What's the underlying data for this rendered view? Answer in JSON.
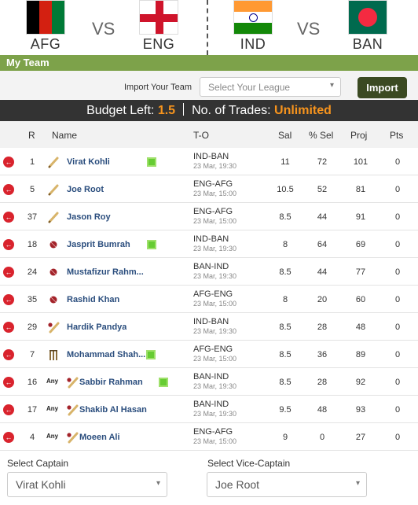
{
  "matches": [
    {
      "home": "AFG",
      "away": "ENG",
      "vs": "VS"
    },
    {
      "home": "IND",
      "away": "BAN",
      "vs": "VS"
    }
  ],
  "section_title": "My Team",
  "import": {
    "label": "Import Your Team",
    "league_placeholder": "Select Your League",
    "button": "Import"
  },
  "budget": {
    "budget_label": "Budget Left:",
    "budget_value": "1.5",
    "trades_label": "No. of Trades:",
    "trades_value": "Unlimited"
  },
  "columns": [
    "R",
    "Name",
    "T-O",
    "Sal",
    "% Sel",
    "Proj",
    "Pts"
  ],
  "players": [
    {
      "rank": "1",
      "any": "",
      "role": "bat",
      "name": "Virat Kohli",
      "badge": true,
      "match": "IND-BAN",
      "date": "23 Mar, 19:30",
      "sal": "11",
      "sel": "72",
      "proj": "101",
      "pts": "0"
    },
    {
      "rank": "5",
      "any": "",
      "role": "bat",
      "name": "Joe Root",
      "badge": false,
      "match": "ENG-AFG",
      "date": "23 Mar, 15:00",
      "sal": "10.5",
      "sel": "52",
      "proj": "81",
      "pts": "0"
    },
    {
      "rank": "37",
      "any": "",
      "role": "bat",
      "name": "Jason Roy",
      "badge": false,
      "match": "ENG-AFG",
      "date": "23 Mar, 15:00",
      "sal": "8.5",
      "sel": "44",
      "proj": "91",
      "pts": "0"
    },
    {
      "rank": "18",
      "any": "",
      "role": "bowl",
      "name": "Jasprit Bumrah",
      "badge": true,
      "match": "IND-BAN",
      "date": "23 Mar, 19:30",
      "sal": "8",
      "sel": "64",
      "proj": "69",
      "pts": "0"
    },
    {
      "rank": "24",
      "any": "",
      "role": "bowl",
      "name": "Mustafizur Rahm...",
      "badge": false,
      "match": "BAN-IND",
      "date": "23 Mar, 19:30",
      "sal": "8.5",
      "sel": "44",
      "proj": "77",
      "pts": "0"
    },
    {
      "rank": "35",
      "any": "",
      "role": "bowl",
      "name": "Rashid Khan",
      "badge": false,
      "match": "AFG-ENG",
      "date": "23 Mar, 15:00",
      "sal": "8",
      "sel": "20",
      "proj": "60",
      "pts": "0"
    },
    {
      "rank": "29",
      "any": "",
      "role": "allround",
      "name": "Hardik Pandya",
      "badge": false,
      "match": "IND-BAN",
      "date": "23 Mar, 19:30",
      "sal": "8.5",
      "sel": "28",
      "proj": "48",
      "pts": "0"
    },
    {
      "rank": "7",
      "any": "",
      "role": "wk",
      "name": "Mohammad Shah...",
      "badge": true,
      "match": "AFG-ENG",
      "date": "23 Mar, 15:00",
      "sal": "8.5",
      "sel": "36",
      "proj": "89",
      "pts": "0"
    },
    {
      "rank": "16",
      "any": "Any",
      "role": "allround",
      "name": "Sabbir Rahman",
      "badge": true,
      "match": "BAN-IND",
      "date": "23 Mar, 19:30",
      "sal": "8.5",
      "sel": "28",
      "proj": "92",
      "pts": "0"
    },
    {
      "rank": "17",
      "any": "Any",
      "role": "allround",
      "name": "Shakib Al Hasan",
      "badge": false,
      "match": "BAN-IND",
      "date": "23 Mar, 19:30",
      "sal": "9.5",
      "sel": "48",
      "proj": "93",
      "pts": "0"
    },
    {
      "rank": "4",
      "any": "Any",
      "role": "allround",
      "name": "Moeen Ali",
      "badge": false,
      "match": "ENG-AFG",
      "date": "23 Mar, 15:00",
      "sal": "9",
      "sel": "0",
      "proj": "27",
      "pts": "0"
    }
  ],
  "captain": {
    "label": "Select Captain",
    "value": "Virat Kohli"
  },
  "vice_captain": {
    "label": "Select Vice-Captain",
    "value": "Joe Root"
  },
  "colors": {
    "accent_green": "#7da24a",
    "import_button": "#3b4a22",
    "budget_bar": "#333333",
    "highlight_orange": "#f7941d",
    "remove_red": "#d9232d",
    "badge_green": "#66cc33",
    "player_link": "#2a4d7d"
  },
  "icons": {
    "remove": "circle-arrow-left-icon",
    "bat": "bat-icon",
    "bowl": "ball-icon",
    "allround": "bat-ball-icon",
    "wk": "stumps-icon",
    "select": "chevron-down-icon"
  }
}
